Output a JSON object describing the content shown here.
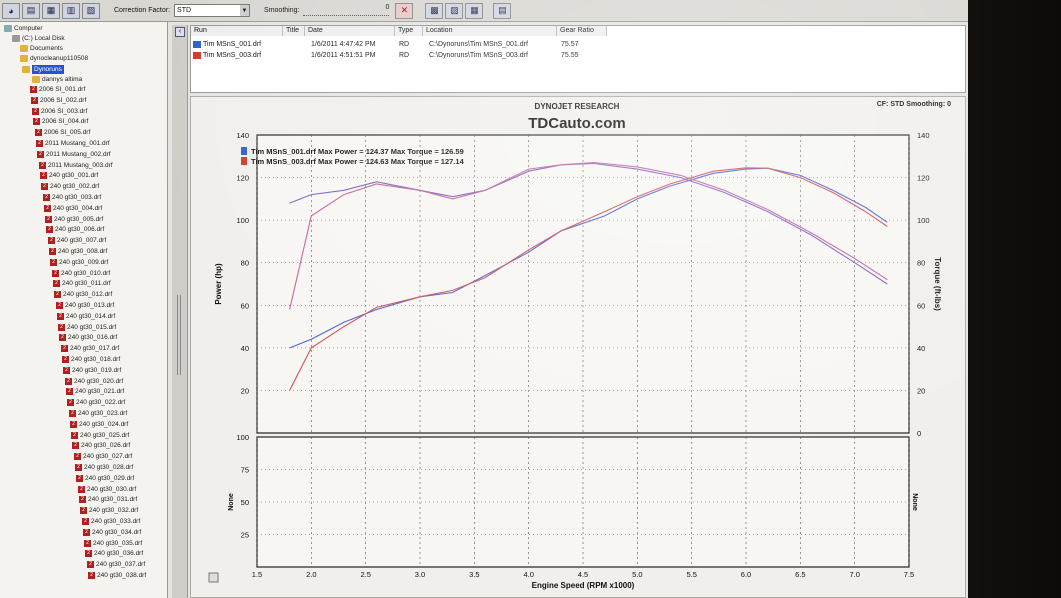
{
  "toolbar": {
    "correction_label": "Correction Factor:",
    "correction_value": "STD",
    "smoothing_label": "Smoothing:",
    "smoothing_value": "0"
  },
  "tree": {
    "computer": "Computer",
    "local_disk": "(C:) Local Disk",
    "documents": "Documents",
    "dynocleanup": "dynocleanup110508",
    "dynoruns": "Dynoruns",
    "subfolder": "dannys altima",
    "files": [
      "2006 SI_001.drf",
      "2006 SI_002.drf",
      "2006 SI_003.drf",
      "2006 SI_004.drf",
      "2006 SI_005.drf",
      "2011 Mustang_001.drf",
      "2011 Mustang_002.drf",
      "2011 Mustang_003.drf",
      "240 gt30_001.drf",
      "240 gt30_002.drf",
      "240 gt30_003.drf",
      "240 gt30_004.drf",
      "240 gt30_005.drf",
      "240 gt30_006.drf",
      "240 gt30_007.drf",
      "240 gt30_008.drf",
      "240 gt30_009.drf",
      "240 gt30_010.drf",
      "240 gt30_011.drf",
      "240 gt30_012.drf",
      "240 gt30_013.drf",
      "240 gt30_014.drf",
      "240 gt30_015.drf",
      "240 gt30_016.drf",
      "240 gt30_017.drf",
      "240 gt30_018.drf",
      "240 gt30_019.drf",
      "240 gt30_020.drf",
      "240 gt30_021.drf",
      "240 gt30_022.drf",
      "240 gt30_023.drf",
      "240 gt30_024.drf",
      "240 gt30_025.drf",
      "240 gt30_026.drf",
      "240 gt30_027.drf",
      "240 gt30_028.drf",
      "240 gt30_029.drf",
      "240 gt30_030.drf",
      "240 gt30_031.drf",
      "240 gt30_032.drf",
      "240 gt30_033.drf",
      "240 gt30_034.drf",
      "240 gt30_035.drf",
      "240 gt30_036.drf",
      "240 gt30_037.drf",
      "240 gt30_038.drf"
    ]
  },
  "runs": {
    "headers": [
      "Run",
      "Title",
      "Date",
      "Type",
      "Location",
      "Gear Ratio"
    ],
    "rows": [
      {
        "run": "Tim MSnS_001.drf",
        "date": "1/6/2011 4:47:42 PM",
        "type": "RD",
        "location": "C:\\Dynoruns\\Tim MSnS_001.drf",
        "gear_ratio": "75.57",
        "color": "#2f5fd0"
      },
      {
        "run": "Tim MSnS_003.drf",
        "date": "1/6/2011 4:51:51 PM",
        "type": "RD",
        "location": "C:\\Dynoruns\\Tim MSnS_003.drf",
        "gear_ratio": "75.55",
        "color": "#d23a2a"
      }
    ]
  },
  "header": {
    "company": "DYNOJET RESEARCH",
    "site": "TDCauto.com",
    "status": "CF: STD  Smoothing: 0"
  },
  "legend": [
    "Tim MSnS_001.drf Max Power = 124.37 Max Torque = 126.59",
    "Tim MSnS_003.drf Max Power = 124.63 Max Torque = 127.14"
  ],
  "chart_data": [
    {
      "type": "line",
      "xlabel": "Engine Speed (RPM x1000)",
      "ylabel": "Power (hp)",
      "y2label": "Torque (ft-lbs)",
      "xlim": [
        1.5,
        7.5
      ],
      "ylim": [
        0,
        140
      ],
      "y2lim": [
        0,
        140
      ],
      "x_ticks": [
        1.5,
        2.0,
        2.5,
        3.0,
        3.5,
        4.0,
        4.5,
        5.0,
        5.5,
        6.0,
        6.5,
        7.0,
        7.5
      ],
      "y_ticks": [
        20,
        40,
        60,
        80,
        100,
        120,
        140
      ],
      "y2_ticks": [
        0,
        20,
        40,
        60,
        80,
        100,
        120,
        140
      ],
      "grid": true,
      "series": [
        {
          "name": "Tim MSnS_001.drf Power",
          "color": "#4a5fd8",
          "axis": "left",
          "x": [
            1.8,
            2.0,
            2.3,
            2.6,
            3.0,
            3.3,
            3.6,
            4.0,
            4.3,
            4.7,
            5.0,
            5.3,
            5.7,
            6.0,
            6.2,
            6.5,
            6.8,
            7.1,
            7.3
          ],
          "y": [
            40,
            44,
            52,
            58,
            64,
            66,
            74,
            85,
            95,
            102,
            110,
            116,
            122,
            124,
            124.4,
            121,
            114,
            106,
            99
          ]
        },
        {
          "name": "Tim MSnS_003.drf Power",
          "color": "#d05050",
          "axis": "left",
          "x": [
            1.8,
            2.0,
            2.3,
            2.6,
            3.0,
            3.3,
            3.6,
            4.0,
            4.3,
            4.7,
            5.0,
            5.3,
            5.7,
            6.0,
            6.2,
            6.5,
            6.8,
            7.1,
            7.3
          ],
          "y": [
            20,
            40,
            50,
            59,
            64,
            67,
            73,
            86,
            95,
            104,
            111,
            117,
            123,
            124.6,
            124.4,
            120,
            113,
            104,
            97
          ]
        },
        {
          "name": "Tim MSnS_001.drf Torque",
          "color": "#7b5fc8",
          "axis": "right",
          "x": [
            1.8,
            2.0,
            2.3,
            2.6,
            3.0,
            3.3,
            3.6,
            4.0,
            4.3,
            4.6,
            5.0,
            5.4,
            5.8,
            6.2,
            6.6,
            7.0,
            7.3
          ],
          "y": [
            108,
            112,
            114,
            118,
            114,
            111,
            114,
            123,
            126,
            126.6,
            124,
            120,
            113,
            104,
            93,
            80,
            70
          ]
        },
        {
          "name": "Tim MSnS_003.drf Torque",
          "color": "#c5609a",
          "axis": "right",
          "x": [
            1.8,
            2.0,
            2.3,
            2.6,
            3.0,
            3.3,
            3.6,
            4.0,
            4.3,
            4.6,
            5.0,
            5.4,
            5.8,
            6.2,
            6.6,
            7.0,
            7.3
          ],
          "y": [
            58,
            102,
            112,
            117,
            114,
            110,
            114,
            124,
            126,
            127.1,
            125,
            121,
            114,
            105,
            94,
            82,
            72
          ]
        }
      ]
    },
    {
      "type": "line",
      "xlabel": "Engine Speed (RPM x1000)",
      "ylabel": "None",
      "y2label": "None",
      "xlim": [
        1.5,
        7.5
      ],
      "ylim": [
        0,
        100
      ],
      "y_ticks": [
        25,
        50,
        75,
        100
      ],
      "grid": true,
      "series": []
    }
  ]
}
